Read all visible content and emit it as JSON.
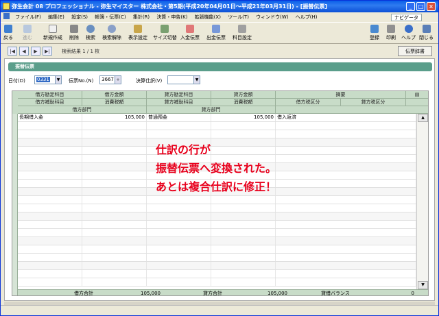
{
  "window": {
    "title": "弥生会計 08 プロフェッショナル - 弥生マイスター 株式会社・第5期(平成20年04月01日～平成21年03月31日) - [振替伝票]"
  },
  "menu": {
    "items": [
      "ファイル(F)",
      "編集(E)",
      "設定(S)",
      "帳簿・伝票(C)",
      "集計(R)",
      "決算・申告(K)",
      "拡張機能(X)",
      "ツール(T)",
      "ウィンドウ(W)",
      "ヘルプ(H)"
    ],
    "navi_label": "ナビゲータ"
  },
  "toolbar": {
    "back": "戻る",
    "forward": "進む",
    "new": "新規作成",
    "delete": "削除",
    "search": "検索",
    "search_clear": "検索解除",
    "display_settings": "表示設定",
    "size_toggle": "サイズ切替",
    "deposit_voucher": "入金伝票",
    "payment_voucher": "出金伝票",
    "account_settings": "科目設定",
    "register": "登録",
    "print": "印刷",
    "help": "ヘルプ",
    "close": "閉じる"
  },
  "navigation": {
    "result_text": "検索結果 1 / 1 枚",
    "dict_button": "伝票辞書"
  },
  "section": {
    "title": "振替伝票"
  },
  "filter": {
    "date_label": "日付(D)",
    "date_value": "0331",
    "voucher_no_label": "伝票No.(N)",
    "voucher_no_value": "3667",
    "closing_label": "決算仕訳(V)",
    "closing_value": ""
  },
  "grid": {
    "header_row1": [
      "借方勘定科目",
      "借方金額",
      "貸方勘定科目",
      "貸方金額",
      "摘要"
    ],
    "header_row2": [
      "借方補助科目",
      "消費税額",
      "貸方補助科目",
      "消費税額",
      "借方税区分",
      "貸方税区分"
    ],
    "header_row3": [
      "借方部門",
      "貸方部門"
    ],
    "rows": [
      {
        "debit_account": "長期借入金",
        "debit_amount": "105,000",
        "credit_account": "普通預金",
        "credit_amount": "105,000",
        "memo": "借入返済"
      }
    ],
    "footer": {
      "debit_total_label": "借方合計",
      "debit_total": "105,000",
      "credit_total_label": "貸方合計",
      "credit_total": "105,000",
      "balance_label": "貸借バランス",
      "balance": "0"
    }
  },
  "annotation": {
    "line1": "仕訳の行が",
    "line2": "振替伝票へ変換された。",
    "line3": "あとは複合仕訳に修正！"
  }
}
